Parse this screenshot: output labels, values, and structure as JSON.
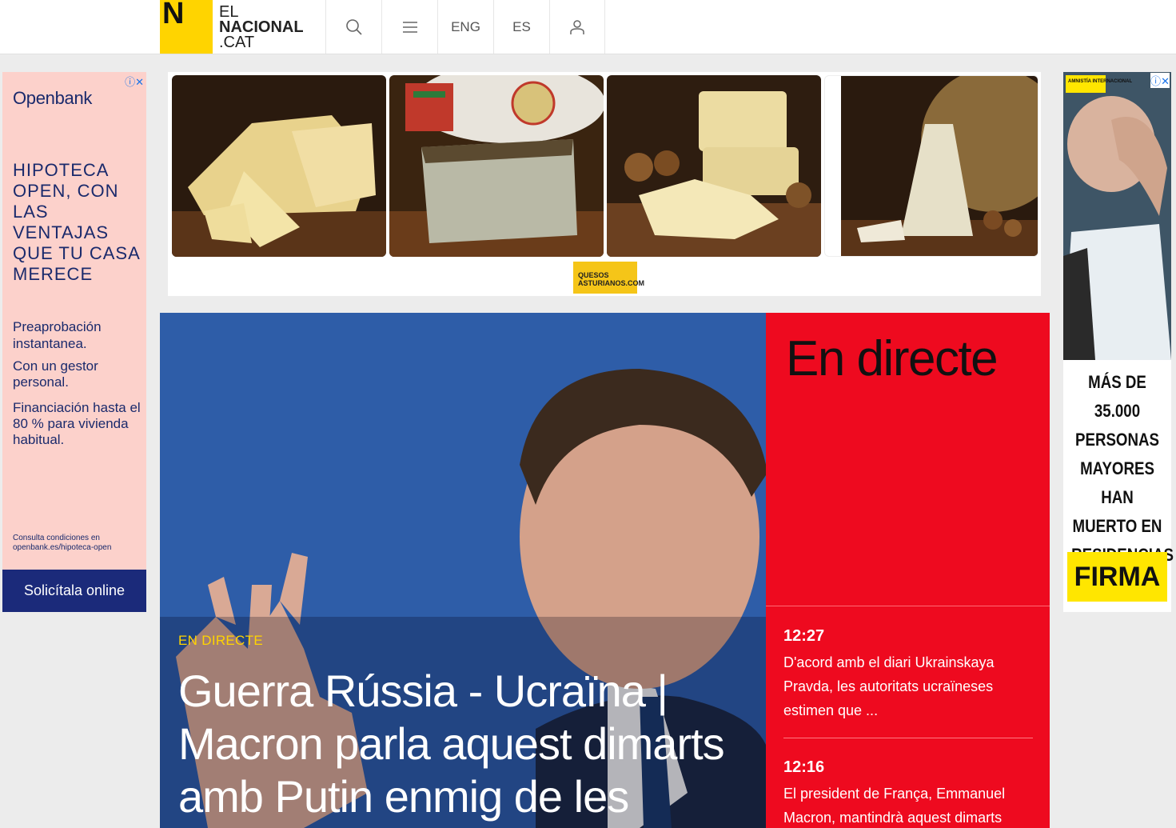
{
  "header": {
    "logo_letter": "N",
    "logo_line1": "EL",
    "logo_line2": "NACIONAL",
    "logo_line3": ".CAT",
    "lang_eng": "ENG",
    "lang_es": "ES",
    "colors": {
      "logo_yellow": "#ffd400"
    }
  },
  "ad_left": {
    "brand": "Openbank",
    "headline": "HIPOTECA OPEN, CON LAS VENTAJAS QUE TU CASA MERECE",
    "point1": "Preaprobación instantanea.",
    "point2": "Con un gestor personal.",
    "point3": "Financiación hasta el 80 % para vivienda habitual.",
    "legal": "Consulta condiciones en openbank.es/hipoteca-open",
    "cta": "Solicítala online",
    "ad_marker": "ⓘ✕"
  },
  "ad_top": {
    "sponsor_logo_text": "QUESOS ASTURIANOS.COM",
    "ad_marker": "ⓘ✕"
  },
  "hero": {
    "kicker": "EN DIRECTE",
    "title": "Guerra Rússia - Ucraïna | Macron parla aquest dimarts amb Putin enmig de les"
  },
  "live": {
    "title": "En directe",
    "items": [
      {
        "time": "12:27",
        "text": "D'acord amb el diari Ukrainskaya Pravda, les autoritats ucraïneses estimen que ..."
      },
      {
        "time": "12:16",
        "text": "El president de França, Emmanuel Macron, mantindrà aquest dimarts"
      }
    ],
    "colors": {
      "background": "#ee0a1f"
    }
  },
  "ad_right": {
    "logo_text": "AMNISTÍA INTERNACIONAL",
    "message": "MÁS DE 35.000 PERSONAS MAYORES HAN MUERTO EN RESIDENCIAS",
    "cta": "FIRMA",
    "ad_marker": "ⓘ✕"
  }
}
